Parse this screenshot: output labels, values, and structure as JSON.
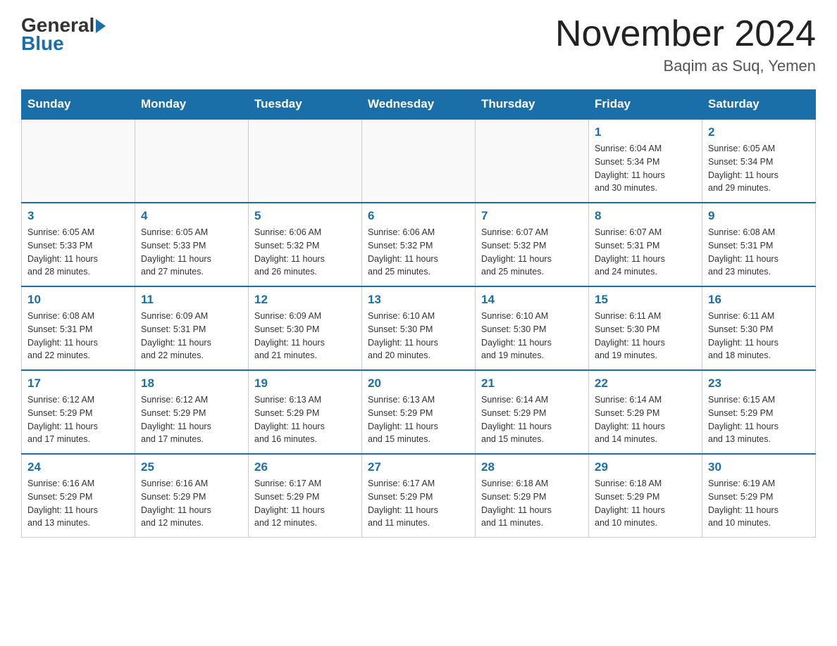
{
  "header": {
    "logo_general": "General",
    "logo_blue": "Blue",
    "month_year": "November 2024",
    "location": "Baqim as Suq, Yemen"
  },
  "weekdays": [
    "Sunday",
    "Monday",
    "Tuesday",
    "Wednesday",
    "Thursday",
    "Friday",
    "Saturday"
  ],
  "weeks": [
    [
      {
        "day": "",
        "info": ""
      },
      {
        "day": "",
        "info": ""
      },
      {
        "day": "",
        "info": ""
      },
      {
        "day": "",
        "info": ""
      },
      {
        "day": "",
        "info": ""
      },
      {
        "day": "1",
        "info": "Sunrise: 6:04 AM\nSunset: 5:34 PM\nDaylight: 11 hours\nand 30 minutes."
      },
      {
        "day": "2",
        "info": "Sunrise: 6:05 AM\nSunset: 5:34 PM\nDaylight: 11 hours\nand 29 minutes."
      }
    ],
    [
      {
        "day": "3",
        "info": "Sunrise: 6:05 AM\nSunset: 5:33 PM\nDaylight: 11 hours\nand 28 minutes."
      },
      {
        "day": "4",
        "info": "Sunrise: 6:05 AM\nSunset: 5:33 PM\nDaylight: 11 hours\nand 27 minutes."
      },
      {
        "day": "5",
        "info": "Sunrise: 6:06 AM\nSunset: 5:32 PM\nDaylight: 11 hours\nand 26 minutes."
      },
      {
        "day": "6",
        "info": "Sunrise: 6:06 AM\nSunset: 5:32 PM\nDaylight: 11 hours\nand 25 minutes."
      },
      {
        "day": "7",
        "info": "Sunrise: 6:07 AM\nSunset: 5:32 PM\nDaylight: 11 hours\nand 25 minutes."
      },
      {
        "day": "8",
        "info": "Sunrise: 6:07 AM\nSunset: 5:31 PM\nDaylight: 11 hours\nand 24 minutes."
      },
      {
        "day": "9",
        "info": "Sunrise: 6:08 AM\nSunset: 5:31 PM\nDaylight: 11 hours\nand 23 minutes."
      }
    ],
    [
      {
        "day": "10",
        "info": "Sunrise: 6:08 AM\nSunset: 5:31 PM\nDaylight: 11 hours\nand 22 minutes."
      },
      {
        "day": "11",
        "info": "Sunrise: 6:09 AM\nSunset: 5:31 PM\nDaylight: 11 hours\nand 22 minutes."
      },
      {
        "day": "12",
        "info": "Sunrise: 6:09 AM\nSunset: 5:30 PM\nDaylight: 11 hours\nand 21 minutes."
      },
      {
        "day": "13",
        "info": "Sunrise: 6:10 AM\nSunset: 5:30 PM\nDaylight: 11 hours\nand 20 minutes."
      },
      {
        "day": "14",
        "info": "Sunrise: 6:10 AM\nSunset: 5:30 PM\nDaylight: 11 hours\nand 19 minutes."
      },
      {
        "day": "15",
        "info": "Sunrise: 6:11 AM\nSunset: 5:30 PM\nDaylight: 11 hours\nand 19 minutes."
      },
      {
        "day": "16",
        "info": "Sunrise: 6:11 AM\nSunset: 5:30 PM\nDaylight: 11 hours\nand 18 minutes."
      }
    ],
    [
      {
        "day": "17",
        "info": "Sunrise: 6:12 AM\nSunset: 5:29 PM\nDaylight: 11 hours\nand 17 minutes."
      },
      {
        "day": "18",
        "info": "Sunrise: 6:12 AM\nSunset: 5:29 PM\nDaylight: 11 hours\nand 17 minutes."
      },
      {
        "day": "19",
        "info": "Sunrise: 6:13 AM\nSunset: 5:29 PM\nDaylight: 11 hours\nand 16 minutes."
      },
      {
        "day": "20",
        "info": "Sunrise: 6:13 AM\nSunset: 5:29 PM\nDaylight: 11 hours\nand 15 minutes."
      },
      {
        "day": "21",
        "info": "Sunrise: 6:14 AM\nSunset: 5:29 PM\nDaylight: 11 hours\nand 15 minutes."
      },
      {
        "day": "22",
        "info": "Sunrise: 6:14 AM\nSunset: 5:29 PM\nDaylight: 11 hours\nand 14 minutes."
      },
      {
        "day": "23",
        "info": "Sunrise: 6:15 AM\nSunset: 5:29 PM\nDaylight: 11 hours\nand 13 minutes."
      }
    ],
    [
      {
        "day": "24",
        "info": "Sunrise: 6:16 AM\nSunset: 5:29 PM\nDaylight: 11 hours\nand 13 minutes."
      },
      {
        "day": "25",
        "info": "Sunrise: 6:16 AM\nSunset: 5:29 PM\nDaylight: 11 hours\nand 12 minutes."
      },
      {
        "day": "26",
        "info": "Sunrise: 6:17 AM\nSunset: 5:29 PM\nDaylight: 11 hours\nand 12 minutes."
      },
      {
        "day": "27",
        "info": "Sunrise: 6:17 AM\nSunset: 5:29 PM\nDaylight: 11 hours\nand 11 minutes."
      },
      {
        "day": "28",
        "info": "Sunrise: 6:18 AM\nSunset: 5:29 PM\nDaylight: 11 hours\nand 11 minutes."
      },
      {
        "day": "29",
        "info": "Sunrise: 6:18 AM\nSunset: 5:29 PM\nDaylight: 11 hours\nand 10 minutes."
      },
      {
        "day": "30",
        "info": "Sunrise: 6:19 AM\nSunset: 5:29 PM\nDaylight: 11 hours\nand 10 minutes."
      }
    ]
  ]
}
